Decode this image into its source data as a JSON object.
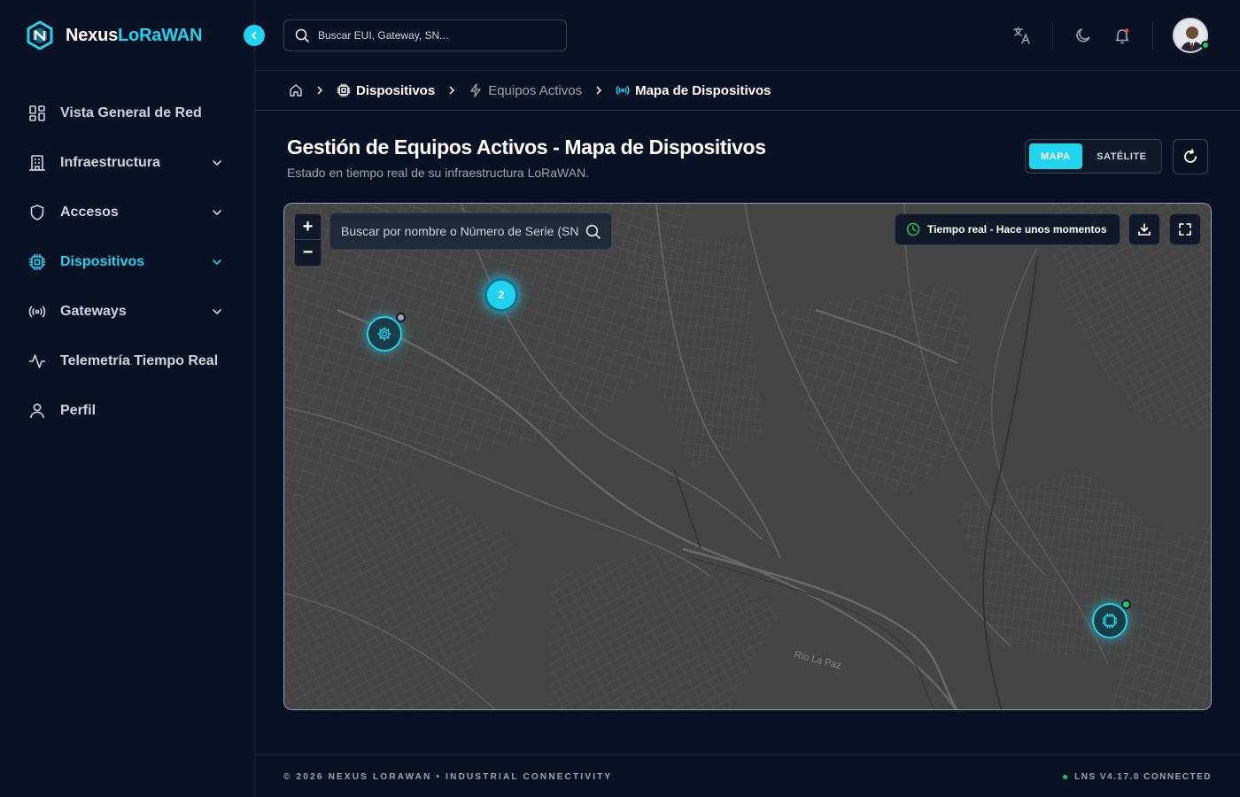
{
  "brand": {
    "name_part1": "Nexus",
    "name_part2": "LoRaWAN"
  },
  "sidebar": {
    "items": [
      {
        "label": "Vista General de Red",
        "icon": "dashboard-grid-icon",
        "has_chevron": false,
        "active": false
      },
      {
        "label": "Infraestructura",
        "icon": "building-icon",
        "has_chevron": true,
        "active": false
      },
      {
        "label": "Accesos",
        "icon": "shield-icon",
        "has_chevron": true,
        "active": false
      },
      {
        "label": "Dispositivos",
        "icon": "chip-icon",
        "has_chevron": true,
        "active": true
      },
      {
        "label": "Gateways",
        "icon": "broadcast-icon",
        "has_chevron": true,
        "active": false
      },
      {
        "label": "Telemetría Tiempo Real",
        "icon": "activity-icon",
        "has_chevron": false,
        "active": false
      },
      {
        "label": "Perfil",
        "icon": "user-icon",
        "has_chevron": false,
        "active": false
      }
    ]
  },
  "topbar": {
    "search_placeholder": "Buscar EUI, Gateway, SN..."
  },
  "breadcrumb": {
    "home_icon": "home-icon",
    "items": [
      "Dispositivos",
      "Equipos Activos",
      "Mapa de Dispositivos"
    ]
  },
  "page": {
    "title": "Gestión de Equipos Activos - Mapa de Dispositivos",
    "subtitle": "Estado en tiempo real de su infraestructura LoRaWAN."
  },
  "view_toggle": {
    "map_label": "MAPA",
    "satellite_label": "SATÉLITE",
    "selected": "MAPA"
  },
  "map": {
    "zoom_in": "+",
    "zoom_out": "−",
    "search_placeholder": "Buscar por nombre o Número de Serie (SN)",
    "live_status": "Tiempo real - Hace unos momentos",
    "cluster_count": "2",
    "river_label": "Río La Paz",
    "markers": [
      {
        "type": "gear",
        "status_color": "#9ca3af"
      },
      {
        "type": "chip",
        "status_color": "#22c55e"
      }
    ]
  },
  "colors": {
    "accent": "#22d3ee",
    "online": "#22c55e",
    "offline": "#9ca3af"
  },
  "footer": {
    "copyright": "© 2026 NEXUS LORAWAN • INDUSTRIAL CONNECTIVITY",
    "version": "LNS V4.17.0 CONNECTED"
  }
}
